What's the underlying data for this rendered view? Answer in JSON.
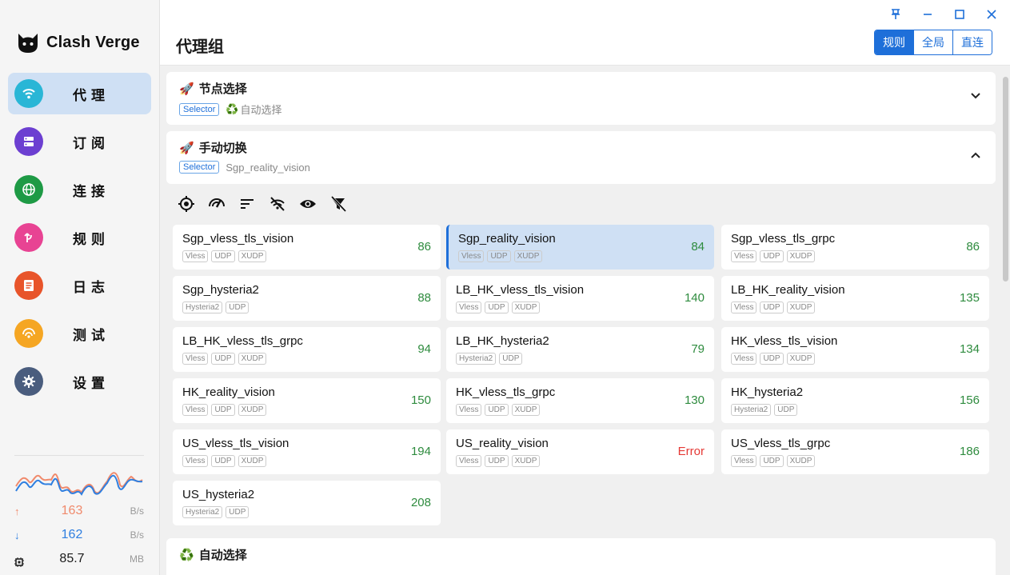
{
  "app": {
    "name": "Clash Verge"
  },
  "sidebar": {
    "items": [
      {
        "label": "代理",
        "icon": "wifi-icon",
        "color": "#29b6d6",
        "active": true
      },
      {
        "label": "订阅",
        "icon": "server-icon",
        "color": "#6c3fd1",
        "active": false
      },
      {
        "label": "连接",
        "icon": "globe-icon",
        "color": "#1e9a45",
        "active": false
      },
      {
        "label": "规则",
        "icon": "fork-icon",
        "color": "#e84393",
        "active": false
      },
      {
        "label": "日志",
        "icon": "list-icon",
        "color": "#e8542a",
        "active": false
      },
      {
        "label": "测试",
        "icon": "radar-icon",
        "color": "#f5a623",
        "active": false
      },
      {
        "label": "设置",
        "icon": "gear-icon",
        "color": "#4a5d7e",
        "active": false
      }
    ],
    "traffic": {
      "up_value": "163",
      "up_unit": "B/s",
      "down_value": "162",
      "down_unit": "B/s",
      "mem_value": "85.7",
      "mem_unit": "MB"
    }
  },
  "header": {
    "title": "代理组",
    "modes": [
      {
        "label": "规则",
        "active": true
      },
      {
        "label": "全局",
        "active": false
      },
      {
        "label": "直连",
        "active": false
      }
    ]
  },
  "groups": [
    {
      "emoji": "🚀",
      "name": "节点选择",
      "type": "Selector",
      "current_icon": "♻️",
      "current": "自动选择",
      "expanded": false
    },
    {
      "emoji": "🚀",
      "name": "手动切换",
      "type": "Selector",
      "current_icon": "",
      "current": "Sgp_reality_vision",
      "expanded": true
    },
    {
      "emoji": "♻️",
      "name": "自动选择"
    }
  ],
  "proxies": [
    {
      "name": "Sgp_vless_tls_vision",
      "tags": [
        "Vless",
        "UDP",
        "XUDP"
      ],
      "delay": "86",
      "selected": false
    },
    {
      "name": "Sgp_reality_vision",
      "tags": [
        "Vless",
        "UDP",
        "XUDP"
      ],
      "delay": "84",
      "selected": true
    },
    {
      "name": "Sgp_vless_tls_grpc",
      "tags": [
        "Vless",
        "UDP",
        "XUDP"
      ],
      "delay": "86",
      "selected": false
    },
    {
      "name": "Sgp_hysteria2",
      "tags": [
        "Hysteria2",
        "UDP"
      ],
      "delay": "88",
      "selected": false
    },
    {
      "name": "LB_HK_vless_tls_vision",
      "tags": [
        "Vless",
        "UDP",
        "XUDP"
      ],
      "delay": "140",
      "selected": false
    },
    {
      "name": "LB_HK_reality_vision",
      "tags": [
        "Vless",
        "UDP",
        "XUDP"
      ],
      "delay": "135",
      "selected": false
    },
    {
      "name": "LB_HK_vless_tls_grpc",
      "tags": [
        "Vless",
        "UDP",
        "XUDP"
      ],
      "delay": "94",
      "selected": false
    },
    {
      "name": "LB_HK_hysteria2",
      "tags": [
        "Hysteria2",
        "UDP"
      ],
      "delay": "79",
      "selected": false
    },
    {
      "name": "HK_vless_tls_vision",
      "tags": [
        "Vless",
        "UDP",
        "XUDP"
      ],
      "delay": "134",
      "selected": false
    },
    {
      "name": "HK_reality_vision",
      "tags": [
        "Vless",
        "UDP",
        "XUDP"
      ],
      "delay": "150",
      "selected": false
    },
    {
      "name": "HK_vless_tls_grpc",
      "tags": [
        "Vless",
        "UDP",
        "XUDP"
      ],
      "delay": "130",
      "selected": false
    },
    {
      "name": "HK_hysteria2",
      "tags": [
        "Hysteria2",
        "UDP"
      ],
      "delay": "156",
      "selected": false
    },
    {
      "name": "US_vless_tls_vision",
      "tags": [
        "Vless",
        "UDP",
        "XUDP"
      ],
      "delay": "194",
      "selected": false
    },
    {
      "name": "US_reality_vision",
      "tags": [
        "Vless",
        "UDP",
        "XUDP"
      ],
      "delay": "Error",
      "selected": false
    },
    {
      "name": "US_vless_tls_grpc",
      "tags": [
        "Vless",
        "UDP",
        "XUDP"
      ],
      "delay": "186",
      "selected": false
    },
    {
      "name": "US_hysteria2",
      "tags": [
        "Hysteria2",
        "UDP"
      ],
      "delay": "208",
      "selected": false
    }
  ],
  "colors": {
    "accent": "#1e6fd9",
    "delay_ok": "#2e8b3e",
    "delay_error": "#e53935",
    "upload": "#f08a6c",
    "download": "#2f7fe0"
  }
}
